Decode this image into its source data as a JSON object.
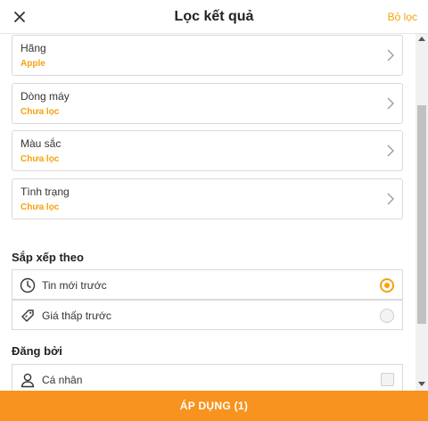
{
  "header": {
    "title": "Lọc kết quả",
    "clear_label": "Bỏ lọc",
    "close_icon": "close-icon"
  },
  "filters": [
    {
      "label": "Hãng",
      "value": "Apple"
    },
    {
      "label": "Dòng máy",
      "value": "Chưa lọc"
    },
    {
      "label": "Màu sắc",
      "value": "Chưa lọc"
    },
    {
      "label": "Tình trạng",
      "value": "Chưa lọc"
    }
  ],
  "sort": {
    "title": "Sắp xếp theo",
    "options": [
      {
        "label": "Tin mới trước",
        "icon": "clock-icon",
        "selected": true
      },
      {
        "label": "Giá thấp trước",
        "icon": "price-tag-icon",
        "selected": false
      }
    ]
  },
  "posted_by": {
    "title": "Đăng bởi",
    "options": [
      {
        "label": "Cá nhân",
        "icon": "person-icon",
        "checked": false
      }
    ]
  },
  "apply_label": "ÁP DỤNG (1)",
  "colors": {
    "accent": "#f5a20a",
    "apply_bg": "#f7931e"
  }
}
